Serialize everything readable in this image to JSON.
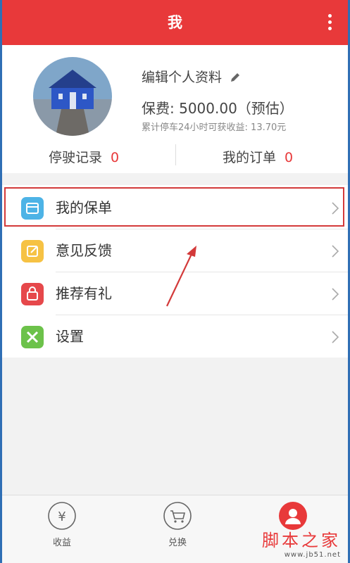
{
  "header": {
    "title": "我"
  },
  "profile": {
    "edit_label": "编辑个人资料",
    "fee_text": "保费: 5000.00（预估）",
    "earn_text": "累计停车24小时可获收益: 13.70元",
    "stats": [
      {
        "label": "停驶记录",
        "value": "0"
      },
      {
        "label": "我的订单",
        "value": "0"
      }
    ]
  },
  "menu": [
    {
      "label": "我的保单",
      "icon": "policy-icon",
      "color": "#4db3e6"
    },
    {
      "label": "意见反馈",
      "icon": "feedback-icon",
      "color": "#f6c244"
    },
    {
      "label": "推荐有礼",
      "icon": "gift-icon",
      "color": "#e6484b"
    },
    {
      "label": "设置",
      "icon": "settings-icon",
      "color": "#6cc24a"
    }
  ],
  "tabs": [
    {
      "label": "收益",
      "icon": "yen-icon"
    },
    {
      "label": "兑换",
      "icon": "cart-icon"
    },
    {
      "label": "",
      "icon": "user-icon"
    }
  ],
  "watermark": {
    "main": "脚本之家",
    "url": "www.jb51.net"
  },
  "colors": {
    "accent": "#e8393a",
    "highlight": "#d33a3a"
  }
}
